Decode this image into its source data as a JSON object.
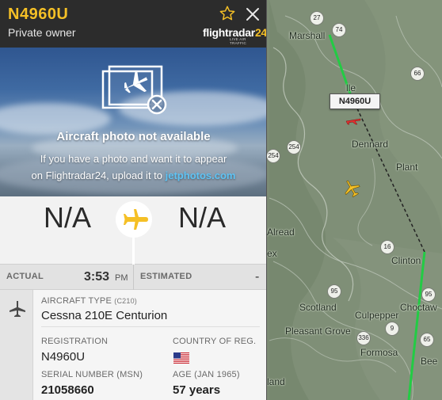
{
  "panel": {
    "callsign": "N4960U",
    "owner": "Private owner",
    "logo": {
      "brand": "flightradar",
      "brand_num": "24",
      "tagline": "LIVE AIR TRAFFIC"
    },
    "icons": {
      "favorite": "star-icon",
      "close": "close-icon"
    }
  },
  "photo": {
    "title": "Aircraft photo not available",
    "message_line1": "If you have a photo and want it to appear",
    "message_line2": "on Flightradar24, upload it to",
    "link_text": "jetphotos.com",
    "icon": "photo-missing-icon"
  },
  "route": {
    "origin": "N/A",
    "destination": "N/A",
    "icon": "airplane-icon"
  },
  "times": {
    "actual_label": "ACTUAL",
    "actual_time": "3:53",
    "actual_ampm": "PM",
    "estimated_label": "ESTIMATED",
    "estimated_value": "-"
  },
  "details": {
    "aircraft_type_label": "AIRCRAFT TYPE",
    "aircraft_type_code": "(C210)",
    "aircraft_type": "Cessna 210E Centurion",
    "registration_label": "REGISTRATION",
    "registration": "N4960U",
    "country_label": "COUNTRY OF REG.",
    "country_flag": "us-flag-icon",
    "serial_label": "SERIAL NUMBER (MSN)",
    "serial": "21058660",
    "age_label": "AGE (JAN 1965)",
    "age": "57 years"
  },
  "map": {
    "flight_tag": "N4960U",
    "places": [
      "Marshall",
      "Dennard",
      "Plant",
      "Alread",
      "Clinton",
      "Scotland",
      "Choctaw",
      "Culpepper",
      "Pleasant Grove",
      "Formosa",
      "Bee",
      "lle",
      "ex",
      "land"
    ],
    "shields": [
      "27",
      "74",
      "66",
      "254",
      "254",
      "16",
      "95",
      "95",
      "9",
      "336",
      "65",
      "65"
    ],
    "colors": {
      "track_green": "#22cc44",
      "track_dashed": "#222222",
      "aircraft": "#f5c026",
      "selected": "#e03030"
    }
  },
  "colors": {
    "header_bg": "#2c2c2c",
    "accent_yellow": "#f5c026",
    "link_blue": "#5ec4f5"
  }
}
